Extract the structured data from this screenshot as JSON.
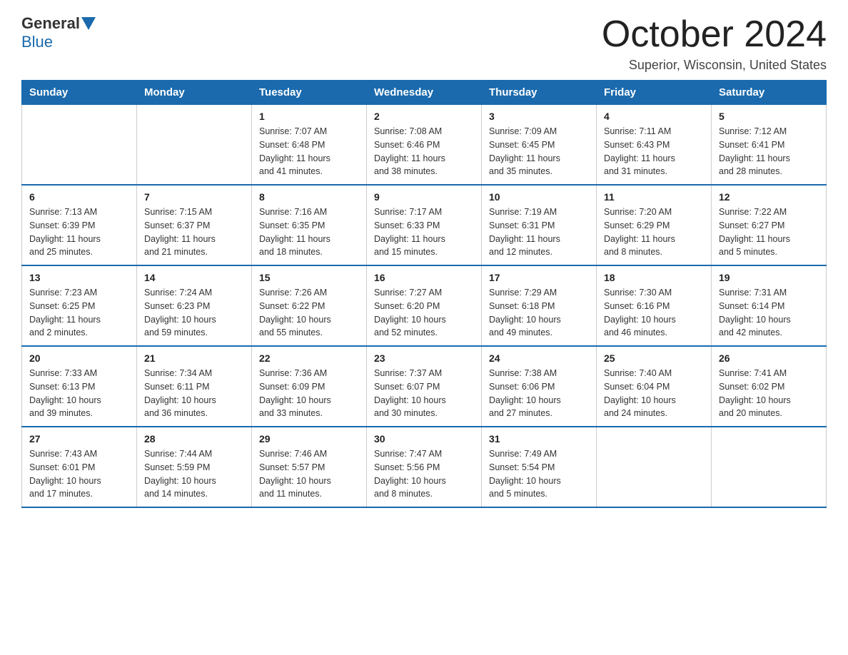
{
  "header": {
    "logo_general": "General",
    "logo_blue": "Blue",
    "title": "October 2024",
    "subtitle": "Superior, Wisconsin, United States"
  },
  "days_of_week": [
    "Sunday",
    "Monday",
    "Tuesday",
    "Wednesday",
    "Thursday",
    "Friday",
    "Saturday"
  ],
  "weeks": [
    [
      {
        "day": "",
        "info": ""
      },
      {
        "day": "",
        "info": ""
      },
      {
        "day": "1",
        "info": "Sunrise: 7:07 AM\nSunset: 6:48 PM\nDaylight: 11 hours\nand 41 minutes."
      },
      {
        "day": "2",
        "info": "Sunrise: 7:08 AM\nSunset: 6:46 PM\nDaylight: 11 hours\nand 38 minutes."
      },
      {
        "day": "3",
        "info": "Sunrise: 7:09 AM\nSunset: 6:45 PM\nDaylight: 11 hours\nand 35 minutes."
      },
      {
        "day": "4",
        "info": "Sunrise: 7:11 AM\nSunset: 6:43 PM\nDaylight: 11 hours\nand 31 minutes."
      },
      {
        "day": "5",
        "info": "Sunrise: 7:12 AM\nSunset: 6:41 PM\nDaylight: 11 hours\nand 28 minutes."
      }
    ],
    [
      {
        "day": "6",
        "info": "Sunrise: 7:13 AM\nSunset: 6:39 PM\nDaylight: 11 hours\nand 25 minutes."
      },
      {
        "day": "7",
        "info": "Sunrise: 7:15 AM\nSunset: 6:37 PM\nDaylight: 11 hours\nand 21 minutes."
      },
      {
        "day": "8",
        "info": "Sunrise: 7:16 AM\nSunset: 6:35 PM\nDaylight: 11 hours\nand 18 minutes."
      },
      {
        "day": "9",
        "info": "Sunrise: 7:17 AM\nSunset: 6:33 PM\nDaylight: 11 hours\nand 15 minutes."
      },
      {
        "day": "10",
        "info": "Sunrise: 7:19 AM\nSunset: 6:31 PM\nDaylight: 11 hours\nand 12 minutes."
      },
      {
        "day": "11",
        "info": "Sunrise: 7:20 AM\nSunset: 6:29 PM\nDaylight: 11 hours\nand 8 minutes."
      },
      {
        "day": "12",
        "info": "Sunrise: 7:22 AM\nSunset: 6:27 PM\nDaylight: 11 hours\nand 5 minutes."
      }
    ],
    [
      {
        "day": "13",
        "info": "Sunrise: 7:23 AM\nSunset: 6:25 PM\nDaylight: 11 hours\nand 2 minutes."
      },
      {
        "day": "14",
        "info": "Sunrise: 7:24 AM\nSunset: 6:23 PM\nDaylight: 10 hours\nand 59 minutes."
      },
      {
        "day": "15",
        "info": "Sunrise: 7:26 AM\nSunset: 6:22 PM\nDaylight: 10 hours\nand 55 minutes."
      },
      {
        "day": "16",
        "info": "Sunrise: 7:27 AM\nSunset: 6:20 PM\nDaylight: 10 hours\nand 52 minutes."
      },
      {
        "day": "17",
        "info": "Sunrise: 7:29 AM\nSunset: 6:18 PM\nDaylight: 10 hours\nand 49 minutes."
      },
      {
        "day": "18",
        "info": "Sunrise: 7:30 AM\nSunset: 6:16 PM\nDaylight: 10 hours\nand 46 minutes."
      },
      {
        "day": "19",
        "info": "Sunrise: 7:31 AM\nSunset: 6:14 PM\nDaylight: 10 hours\nand 42 minutes."
      }
    ],
    [
      {
        "day": "20",
        "info": "Sunrise: 7:33 AM\nSunset: 6:13 PM\nDaylight: 10 hours\nand 39 minutes."
      },
      {
        "day": "21",
        "info": "Sunrise: 7:34 AM\nSunset: 6:11 PM\nDaylight: 10 hours\nand 36 minutes."
      },
      {
        "day": "22",
        "info": "Sunrise: 7:36 AM\nSunset: 6:09 PM\nDaylight: 10 hours\nand 33 minutes."
      },
      {
        "day": "23",
        "info": "Sunrise: 7:37 AM\nSunset: 6:07 PM\nDaylight: 10 hours\nand 30 minutes."
      },
      {
        "day": "24",
        "info": "Sunrise: 7:38 AM\nSunset: 6:06 PM\nDaylight: 10 hours\nand 27 minutes."
      },
      {
        "day": "25",
        "info": "Sunrise: 7:40 AM\nSunset: 6:04 PM\nDaylight: 10 hours\nand 24 minutes."
      },
      {
        "day": "26",
        "info": "Sunrise: 7:41 AM\nSunset: 6:02 PM\nDaylight: 10 hours\nand 20 minutes."
      }
    ],
    [
      {
        "day": "27",
        "info": "Sunrise: 7:43 AM\nSunset: 6:01 PM\nDaylight: 10 hours\nand 17 minutes."
      },
      {
        "day": "28",
        "info": "Sunrise: 7:44 AM\nSunset: 5:59 PM\nDaylight: 10 hours\nand 14 minutes."
      },
      {
        "day": "29",
        "info": "Sunrise: 7:46 AM\nSunset: 5:57 PM\nDaylight: 10 hours\nand 11 minutes."
      },
      {
        "day": "30",
        "info": "Sunrise: 7:47 AM\nSunset: 5:56 PM\nDaylight: 10 hours\nand 8 minutes."
      },
      {
        "day": "31",
        "info": "Sunrise: 7:49 AM\nSunset: 5:54 PM\nDaylight: 10 hours\nand 5 minutes."
      },
      {
        "day": "",
        "info": ""
      },
      {
        "day": "",
        "info": ""
      }
    ]
  ]
}
